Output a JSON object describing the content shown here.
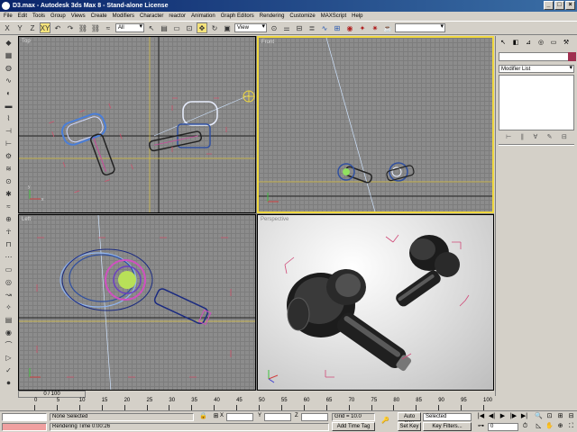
{
  "window": {
    "title": "D3.max - Autodesk 3ds Max 8 - Stand-alone License",
    "minimize": "_",
    "maximize": "□",
    "close": "×"
  },
  "menu": [
    "File",
    "Edit",
    "Tools",
    "Group",
    "Views",
    "Create",
    "Modifiers",
    "Character",
    "reactor",
    "Animation",
    "Graph Editors",
    "Rendering",
    "Customize",
    "MAXScript",
    "Help"
  ],
  "toolbar": {
    "undo": "↶",
    "redo": "↷",
    "link": "⛓",
    "unlink": "⛓",
    "bind": "≈",
    "filter_value": "All",
    "select": "↖",
    "select_name": "▤",
    "region": "▭",
    "window_crossing": "⊡",
    "move": "✥",
    "rotate": "↻",
    "scale": "▣",
    "refcoord_value": "View",
    "pivot": "⊙",
    "axis_x": "X",
    "axis_y": "Y",
    "axis_xy": "XY",
    "axis_z": "Z",
    "mirror": "⚌",
    "align": "⊟",
    "layers": "≣",
    "curve": "∿",
    "schematic": "⊞",
    "material": "◉",
    "render_setup": "✦",
    "render": "✷",
    "quick_render": "☕",
    "named_sel": ""
  },
  "viewports": {
    "top": {
      "label": "Top"
    },
    "front": {
      "label": "Front"
    },
    "left": {
      "label": "Left"
    },
    "perspective": {
      "label": "Perspective"
    }
  },
  "command_panel": {
    "tabs": [
      "↖",
      "◧",
      "⊿",
      "◎",
      "▭",
      "⚒"
    ],
    "object_name": "",
    "modifier_list": "Modifier List",
    "stack_buttons": [
      "⊢",
      "∥",
      "∀",
      "✎",
      "⊟"
    ]
  },
  "timeline": {
    "frame": "0 / 100",
    "ticks": [
      "0",
      "5",
      "10",
      "15",
      "20",
      "25",
      "30",
      "35",
      "40",
      "45",
      "50",
      "55",
      "60",
      "65",
      "70",
      "75",
      "80",
      "85",
      "90",
      "95",
      "100"
    ]
  },
  "status": {
    "selection": "None Selected",
    "prompt": "Rendering Time  0:00:26",
    "x_label": "X",
    "y_label": "Y",
    "z_label": "Z",
    "x_value": "",
    "y_value": "",
    "z_value": "",
    "grid": "Grid = 10.0",
    "add_time_tag": "Add Time Tag",
    "auto_key": "Auto Key",
    "set_key": "Set Key",
    "key_mode": "Selected",
    "key_filters": "Key Filters...",
    "frame_field": "0"
  },
  "playback": {
    "start": "|◀",
    "prev": "◀|",
    "play": "▶",
    "next": "|▶",
    "end": "▶|",
    "zoom": "🔍",
    "pan": "✋",
    "orbit": "⊕",
    "max": "⛶",
    "time_config": "⏱"
  }
}
